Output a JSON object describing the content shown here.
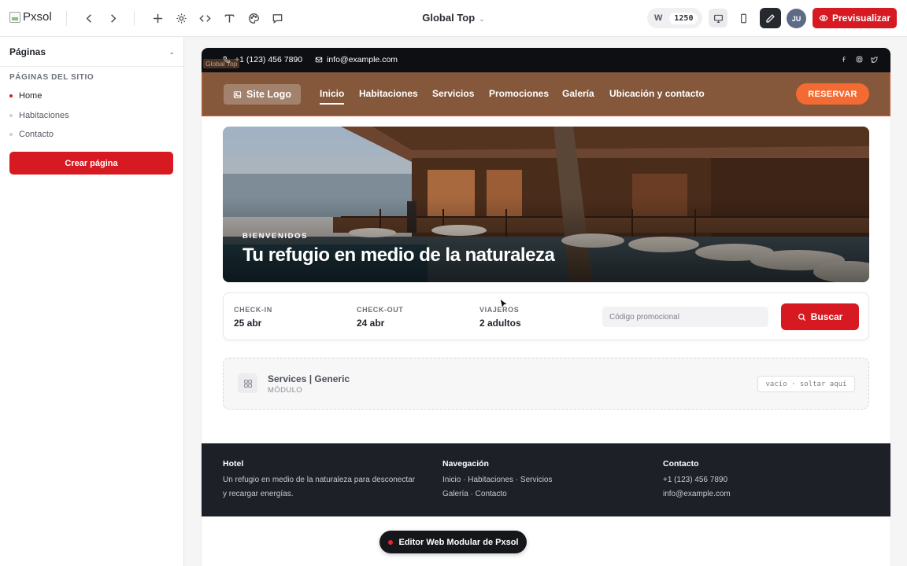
{
  "app": {
    "logo_alt": "Pxsol",
    "document_title": "Global Top",
    "width_label": "W",
    "width_value": "1250",
    "avatar_initials": "JU",
    "preview_label": "Previsualizar"
  },
  "sidebar": {
    "title": "Páginas",
    "section_label": "PÁGINAS DEL SITIO",
    "pages": [
      {
        "label": "Home",
        "active": true
      },
      {
        "label": "Habitaciones",
        "active": false
      },
      {
        "label": "Contacto",
        "active": false
      }
    ],
    "create_label": "Crear página"
  },
  "site": {
    "section_tag": "Global Top",
    "infobar": {
      "phone": "+1 (123) 456 7890",
      "email": "info@example.com",
      "socials": [
        "facebook-icon",
        "instagram-icon",
        "twitter-icon"
      ]
    },
    "nav": {
      "logo_label": "Site Logo",
      "links": [
        "Inicio",
        "Habitaciones",
        "Servicios",
        "Promociones",
        "Galería",
        "Ubicación y contacto"
      ],
      "active_link": "Inicio",
      "cta_label": "RESERVAR",
      "bar_color": "#85583c",
      "cta_color": "#f36b32"
    },
    "hero": {
      "kicker": "BIENVENIDOS",
      "headline": "Tu refugio en medio de la naturaleza"
    },
    "booking": {
      "checkin_label": "CHECK-IN",
      "checkin_value": "25 abr",
      "checkout_label": "CHECK-OUT",
      "checkout_value": "24 abr",
      "guests_label": "VIAJEROS",
      "guests_value": "2 adultos",
      "promo_placeholder": "Código promocional",
      "search_label": "Buscar"
    },
    "module": {
      "title": "Services | Generic",
      "type_label": "MÓDULO",
      "drop_hint": "vacío · soltar aquí"
    },
    "footer": {
      "hotel_heading": "Hotel",
      "hotel_text_1": "Un refugio en medio de la naturaleza para desconectar",
      "hotel_text_2": "y recargar energías.",
      "nav_heading": "Navegación",
      "nav_text_1": "Inicio · Habitaciones · Servicios",
      "nav_text_2": "Galería · Contacto",
      "contact_heading": "Contacto",
      "contact_phone": "+1 (123) 456 7890",
      "contact_email": "info@example.com"
    }
  },
  "editor_badge": "Editor Web Modular de Pxsol",
  "colors": {
    "brand_red": "#d71921",
    "dark": "#1e2027"
  }
}
